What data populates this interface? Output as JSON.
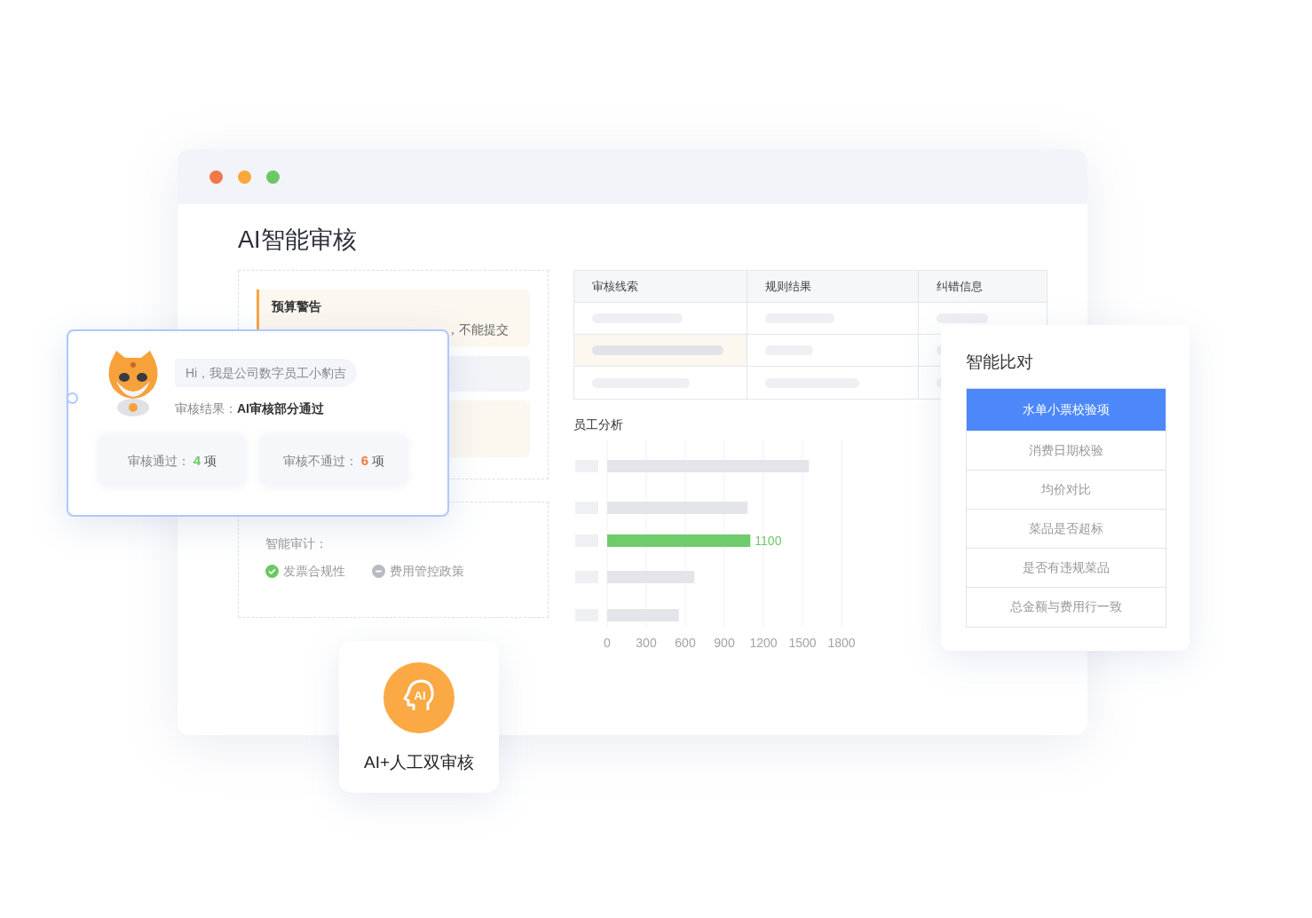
{
  "window": {
    "title": "AI智能审核",
    "dots": [
      {
        "color": "#f0784a"
      },
      {
        "color": "#f8a93a"
      },
      {
        "color": "#6cc864"
      }
    ]
  },
  "budget_warning": {
    "title": "预算警告",
    "message": "，不能提交"
  },
  "audit": {
    "label": "智能审计：",
    "items": [
      {
        "label": "发票合规性",
        "kind": "passed"
      },
      {
        "label": "费用管控政策",
        "kind": "pending"
      }
    ]
  },
  "table": {
    "columns": [
      "审核线索",
      "规则结果",
      "纠错信息"
    ],
    "rows": [
      {
        "selected": false
      },
      {
        "selected": true
      },
      {
        "selected": false
      }
    ]
  },
  "employee_analysis": {
    "title": "员工分析",
    "chart_data": {
      "type": "bar",
      "orientation": "horizontal",
      "grid": true,
      "xlim": [
        0,
        1800
      ],
      "xticks": [
        0,
        300,
        600,
        900,
        1200,
        1500,
        1800
      ],
      "series": [
        {
          "color": "#e4e5ea",
          "values": [
            1550,
            1080,
            null,
            670,
            550
          ]
        },
        {
          "color": "#6fcc6a",
          "values": [
            null,
            null,
            1100,
            null,
            null
          ]
        }
      ],
      "value_labels": [
        null,
        null,
        "1100",
        null,
        null
      ]
    }
  },
  "assistant": {
    "greeting": "Hi，我是公司数字员工小豹吉",
    "result_label": "审核结果：",
    "result": "AI审核部分通过",
    "stats": [
      {
        "label": "审核通过：",
        "count": "4",
        "unit": "项",
        "kind": "pass"
      },
      {
        "label": "审核不通过：",
        "count": "6",
        "unit": "项",
        "kind": "fail"
      }
    ]
  },
  "comparison": {
    "title": "智能比对",
    "items": [
      {
        "label": "水单小票校验项",
        "selected": true
      },
      {
        "label": "消费日期校验",
        "selected": false
      },
      {
        "label": "均价对比",
        "selected": false
      },
      {
        "label": "菜品是否超标",
        "selected": false
      },
      {
        "label": "是否有违规菜品",
        "selected": false
      },
      {
        "label": "总金额与费用行一致",
        "selected": false
      }
    ]
  },
  "badge": {
    "icon_text": "AI",
    "label": "AI+人工双审核"
  }
}
